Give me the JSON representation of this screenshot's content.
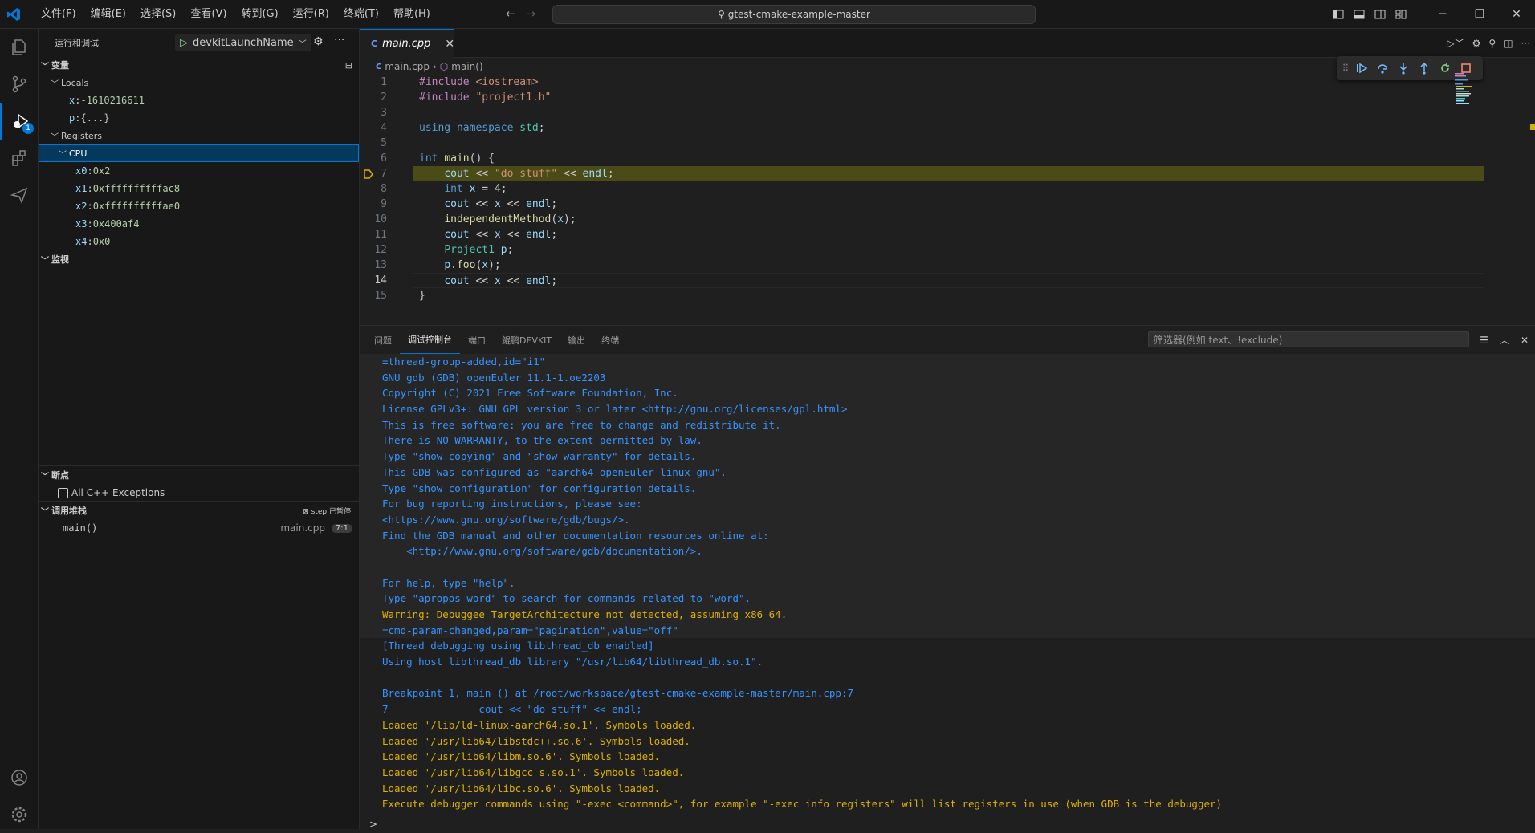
{
  "menu": [
    "文件(F)",
    "编辑(E)",
    "选择(S)",
    "查看(V)",
    "转到(G)",
    "运行(R)",
    "终端(T)",
    "帮助(H)"
  ],
  "command_center": "gtest-cmake-example-master",
  "activity": {
    "debug_badge": "1"
  },
  "sidebar": {
    "title": "运行和调试",
    "launch_config": "devkitLaunchName",
    "variables_header": "变量",
    "locals_label": "Locals",
    "locals": [
      {
        "name": "x",
        "value": "-1610216611"
      },
      {
        "name": "p",
        "value": "{...}"
      }
    ],
    "registers_label": "Registers",
    "cpu_label": "CPU",
    "registers": [
      {
        "name": "x0",
        "value": "0x2"
      },
      {
        "name": "x1",
        "value": "0xffffffffffac8"
      },
      {
        "name": "x2",
        "value": "0xffffffffffae0"
      },
      {
        "name": "x3",
        "value": "0x400af4"
      },
      {
        "name": "x4",
        "value": "0x0"
      }
    ],
    "watch_header": "监视",
    "breakpoints_header": "断点",
    "breakpoint_item": "All C++ Exceptions",
    "callstack_header": "调用堆栈",
    "callstack_status": "step 已暂停",
    "callstack_frame": "main()",
    "callstack_file": "main.cpp",
    "callstack_pos": "7:1"
  },
  "editor": {
    "tab_name": "main.cpp",
    "breadcrumb_file": "main.cpp",
    "breadcrumb_symbol": "main()",
    "lines": [
      {
        "n": "1",
        "html": "<span class='pp'>#include</span> <span class='str'>&lt;iostream&gt;</span>"
      },
      {
        "n": "2",
        "html": "<span class='pp'>#include</span> <span class='str'>\"project1.h\"</span>"
      },
      {
        "n": "3",
        "html": ""
      },
      {
        "n": "4",
        "html": "<span class='kw'>using</span> <span class='kw'>namespace</span> <span class='ty'>std</span>;"
      },
      {
        "n": "5",
        "html": ""
      },
      {
        "n": "6",
        "html": "<span class='kw'>int</span> <span class='fn'>main</span>() {"
      },
      {
        "n": "7",
        "html": "    <span class='id'>cout</span> &lt;&lt; <span class='str'>\"do stuff\"</span> &lt;&lt; <span class='id'>endl</span>;"
      },
      {
        "n": "8",
        "html": "    <span class='kw'>int</span> <span class='id'>x</span> = <span class='num'>4</span>;"
      },
      {
        "n": "9",
        "html": "    <span class='id'>cout</span> &lt;&lt; <span class='id'>x</span> &lt;&lt; <span class='id'>endl</span>;"
      },
      {
        "n": "10",
        "html": "    <span class='fn'>independentMethod</span>(<span class='id'>x</span>);"
      },
      {
        "n": "11",
        "html": "    <span class='id'>cout</span> &lt;&lt; <span class='id'>x</span> &lt;&lt; <span class='id'>endl</span>;"
      },
      {
        "n": "12",
        "html": "    <span class='ty'>Project1</span> <span class='id'>p</span>;"
      },
      {
        "n": "13",
        "html": "    <span class='id'>p</span>.<span class='fn'>foo</span>(<span class='id'>x</span>);"
      },
      {
        "n": "14",
        "html": "    <span class='id'>cout</span> &lt;&lt; <span class='id'>x</span> &lt;&lt; <span class='id'>endl</span>;"
      },
      {
        "n": "15",
        "html": "}"
      }
    ],
    "paused_line": "7",
    "cursor_line": "14"
  },
  "panel": {
    "tabs": [
      "问题",
      "调试控制台",
      "端口",
      "鲲鹏DEVKIT",
      "输出",
      "终端"
    ],
    "active_tab": "调试控制台",
    "filter_placeholder": "筛选器(例如 text、!exclude)",
    "console": [
      {
        "c": "blue",
        "t": "=thread-group-added,id=\"i1\""
      },
      {
        "c": "blue",
        "t": "GNU gdb (GDB) openEuler 11.1-1.oe2203"
      },
      {
        "c": "blue",
        "t": "Copyright (C) 2021 Free Software Foundation, Inc."
      },
      {
        "c": "blue",
        "t": "License GPLv3+: GNU GPL version 3 or later <http://gnu.org/licenses/gpl.html>"
      },
      {
        "c": "blue",
        "t": "This is free software: you are free to change and redistribute it."
      },
      {
        "c": "blue",
        "t": "There is NO WARRANTY, to the extent permitted by law."
      },
      {
        "c": "blue",
        "t": "Type \"show copying\" and \"show warranty\" for details."
      },
      {
        "c": "blue",
        "t": "This GDB was configured as \"aarch64-openEuler-linux-gnu\"."
      },
      {
        "c": "blue",
        "t": "Type \"show configuration\" for configuration details."
      },
      {
        "c": "blue",
        "t": "For bug reporting instructions, please see:"
      },
      {
        "c": "blue",
        "t": "<https://www.gnu.org/software/gdb/bugs/>."
      },
      {
        "c": "blue",
        "t": "Find the GDB manual and other documentation resources online at:"
      },
      {
        "c": "blue",
        "t": "    <http://www.gnu.org/software/gdb/documentation/>."
      },
      {
        "c": "blue",
        "t": ""
      },
      {
        "c": "blue",
        "t": "For help, type \"help\"."
      },
      {
        "c": "blue",
        "t": "Type \"apropos word\" to search for commands related to \"word\"."
      },
      {
        "c": "orange",
        "t": "Warning: Debuggee TargetArchitecture not detected, assuming x86_64."
      },
      {
        "c": "blue",
        "t": "=cmd-param-changed,param=\"pagination\",value=\"off\""
      },
      {
        "c": "blue",
        "t": "[Thread debugging using libthread_db enabled]"
      },
      {
        "c": "blue",
        "t": "Using host libthread_db library \"/usr/lib64/libthread_db.so.1\"."
      },
      {
        "c": "blue",
        "t": ""
      },
      {
        "c": "blue",
        "t": "Breakpoint 1, main () at /root/workspace/gtest-cmake-example-master/main.cpp:7"
      },
      {
        "c": "blue",
        "t": "7\t\tcout << \"do stuff\" << endl;"
      },
      {
        "c": "orange",
        "t": "Loaded '/lib/ld-linux-aarch64.so.1'. Symbols loaded."
      },
      {
        "c": "orange",
        "t": "Loaded '/usr/lib64/libstdc++.so.6'. Symbols loaded."
      },
      {
        "c": "orange",
        "t": "Loaded '/usr/lib64/libm.so.6'. Symbols loaded."
      },
      {
        "c": "orange",
        "t": "Loaded '/usr/lib64/libgcc_s.so.1'. Symbols loaded."
      },
      {
        "c": "orange",
        "t": "Loaded '/usr/lib64/libc.so.6'. Symbols loaded."
      },
      {
        "c": "orange",
        "t": "Execute debugger commands using \"-exec <command>\", for example \"-exec info registers\" will list registers in use (when GDB is the debugger)"
      }
    ],
    "prompt": ">"
  },
  "colors": {
    "accent": "#0078d4",
    "paused_line": "#4b4b18",
    "console_blue": "#3794ff",
    "console_orange": "#ddb100"
  }
}
